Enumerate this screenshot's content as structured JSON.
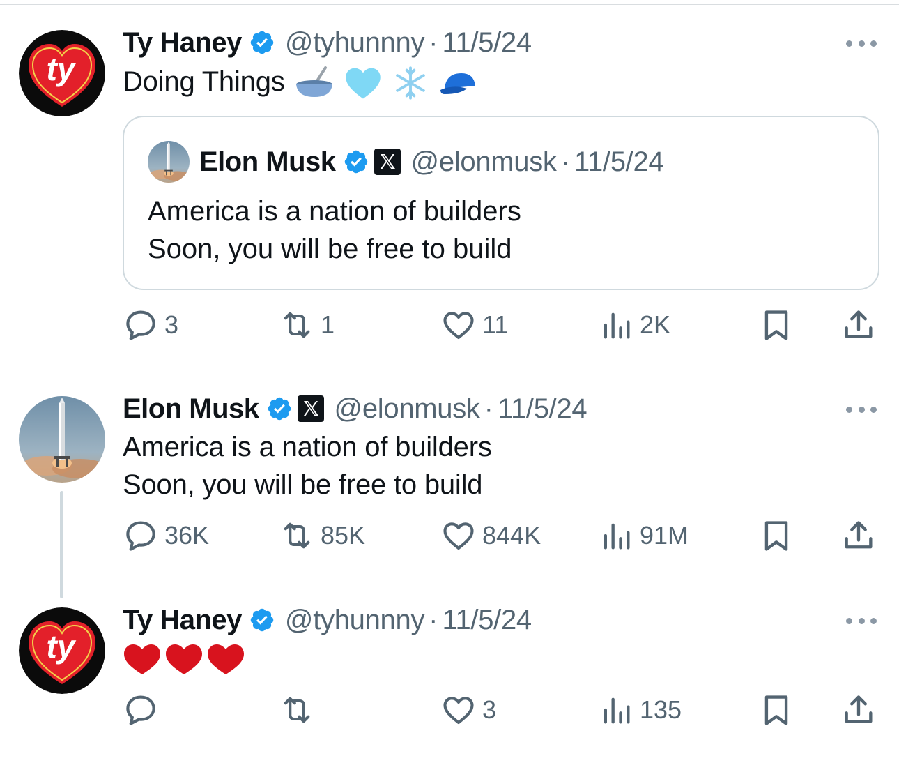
{
  "tweets": [
    {
      "author": "Ty Haney",
      "handle": "@tyhunnny",
      "separator": "·",
      "date": "11/5/24",
      "text": "Doing Things",
      "emojis": [
        "bowl-with-spoon",
        "light-blue-heart",
        "snowflake",
        "blue-cap"
      ],
      "quote": {
        "author": "Elon Musk",
        "handle": "@elonmusk",
        "separator": "·",
        "date": "11/5/24",
        "line1": "America is a nation of builders",
        "line2": "Soon, you will be free to build"
      },
      "stats": {
        "replies": "3",
        "reposts": "1",
        "likes": "11",
        "views": "2K"
      }
    },
    {
      "author": "Elon Musk",
      "handle": "@elonmusk",
      "separator": "·",
      "date": "11/5/24",
      "line1": "America is a nation of builders",
      "line2": "Soon, you will be free to build",
      "stats": {
        "replies": "36K",
        "reposts": "85K",
        "likes": "844K",
        "views": "91M"
      }
    },
    {
      "author": "Ty Haney",
      "handle": "@tyhunnny",
      "separator": "·",
      "date": "11/5/24",
      "text": "❤️❤️❤️",
      "emojis": [
        "red-heart",
        "red-heart",
        "red-heart"
      ],
      "stats": {
        "replies": "",
        "reposts": "",
        "likes": "3",
        "views": "135"
      }
    }
  ],
  "colors": {
    "verified": "#1d9bf0",
    "muted": "#536471",
    "border": "#cfd9de",
    "ty_red": "#e3202a"
  },
  "icons": {
    "reply": "speech-bubble-icon",
    "repost": "repost-arrows-icon",
    "like": "heart-outline-icon",
    "views": "bar-chart-icon",
    "bookmark": "bookmark-icon",
    "share": "share-upload-icon",
    "more": "more-dots-icon"
  }
}
